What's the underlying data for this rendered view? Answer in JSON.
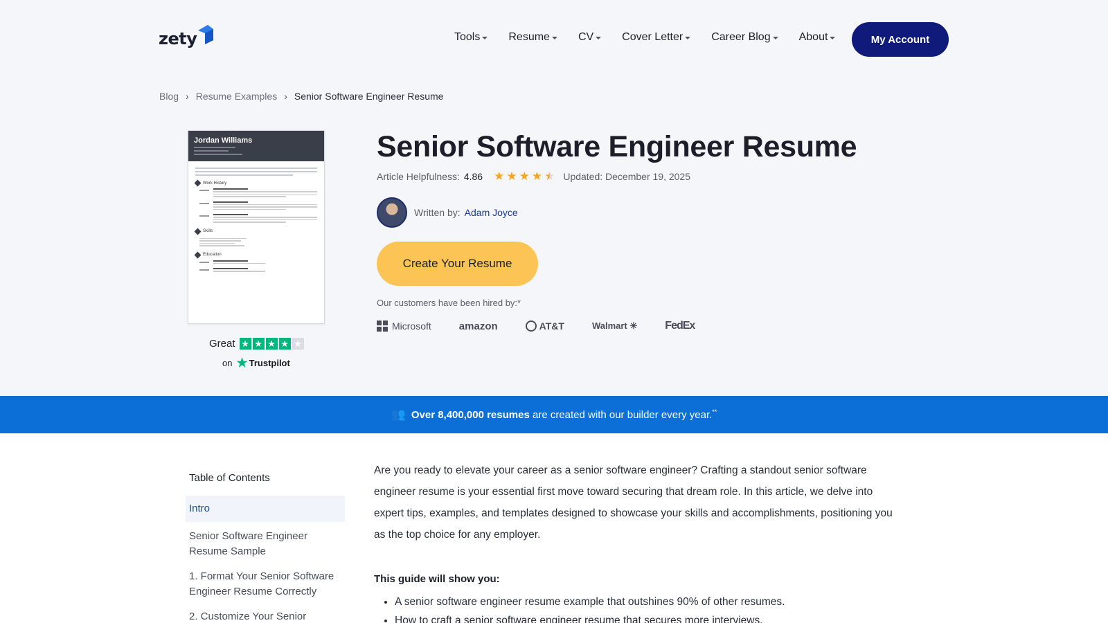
{
  "brand": {
    "name": "zety"
  },
  "nav": {
    "items": [
      "Tools",
      "Resume",
      "CV",
      "Cover Letter",
      "Career Blog",
      "About"
    ],
    "account_button": "My Account"
  },
  "breadcrumb": {
    "items": [
      "Blog",
      "Resume Examples",
      "Senior Software Engineer Resume"
    ]
  },
  "resume_preview": {
    "name": "Jordan Williams",
    "sections": [
      "Work History",
      "Skills",
      "Education"
    ]
  },
  "trustpilot": {
    "label": "Great",
    "on": "on",
    "brand": "Trustpilot",
    "rating_stars": 4
  },
  "article": {
    "title": "Senior Software Engineer Resume",
    "helpfulness_label": "Article Helpfulness:",
    "helpfulness_score": "4.86",
    "rating_value": 4.5,
    "updated": "Updated: December 19, 2025",
    "written_by_label": "Written by:",
    "author": "Adam Joyce",
    "cta": "Create Your Resume",
    "hired_by": "Our customers have been hired by:*",
    "hired_logos": [
      "Microsoft",
      "amazon",
      "AT&T",
      "Walmart",
      "FedEx"
    ]
  },
  "banner": {
    "bold": "Over 8,400,000 resumes",
    "rest": "are created with our builder every year.",
    "sup": "**"
  },
  "toc": {
    "title": "Table of Contents",
    "items": [
      "Intro",
      "Senior Software Engineer Resume Sample",
      "1. Format Your Senior Software Engineer Resume Correctly",
      "2. Customize Your Senior"
    ]
  },
  "intro": {
    "paragraph": "Are you ready to elevate your career as a senior software engineer? Crafting a standout senior software engineer resume is your essential first move toward securing that dream role. In this article, we delve into expert tips, examples, and templates designed to showcase your skills and accomplishments, positioning you as the top choice for any employer.",
    "guide_title": "This guide will show you:",
    "guide_items": [
      "A senior software engineer resume example that outshines 90% of other resumes.",
      "How to craft a senior software engineer resume that secures more interviews."
    ]
  },
  "colors": {
    "account_button": "#0f1a7a",
    "cta": "#fcc455",
    "banner": "#0c6fd8",
    "trustpilot_green": "#00b67a",
    "rating_star": "#f5a623"
  }
}
